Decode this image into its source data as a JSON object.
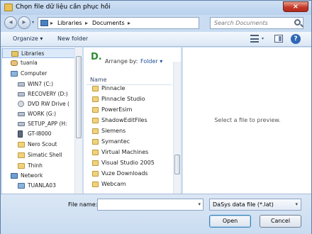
{
  "window": {
    "title": "Chọn file dữ liệu cần phục hồi",
    "close_glyph": "×"
  },
  "address": {
    "root_sep": "▸",
    "crumbs": [
      "Libraries",
      "Documents"
    ],
    "crumb_sep": "▸"
  },
  "search": {
    "placeholder": "Search Documents"
  },
  "toolbar": {
    "organize": "Organize ▾",
    "new_folder": "New folder",
    "help_glyph": "?"
  },
  "nav": {
    "items": [
      {
        "label": "Libraries",
        "icon": "libraries-icon"
      },
      {
        "label": "tuanla",
        "icon": "user-folder-icon"
      },
      {
        "label": "Computer",
        "icon": "computer-icon"
      },
      {
        "label": "WIN7 (C:)",
        "icon": "drive-icon"
      },
      {
        "label": "RECOVERY (D:)",
        "icon": "drive-icon"
      },
      {
        "label": "DVD RW Drive (",
        "icon": "dvd-drive-icon"
      },
      {
        "label": "WORK (G:)",
        "icon": "drive-icon"
      },
      {
        "label": "SETUP_APP (H:",
        "icon": "drive-icon"
      },
      {
        "label": "GT-I8000",
        "icon": "phone-icon"
      },
      {
        "label": "Nero Scout",
        "icon": "folder-icon"
      },
      {
        "label": "Simatic Shell",
        "icon": "folder-icon"
      },
      {
        "label": "Thinh",
        "icon": "folder-icon"
      },
      {
        "label": "Network",
        "icon": "network-icon"
      },
      {
        "label": "TUANLA03",
        "icon": "computer-icon"
      }
    ]
  },
  "content": {
    "arrange_label": "Arrange by:",
    "arrange_value": "Folder ▾",
    "column_name": "Name",
    "files": [
      "Pinnacle",
      "Pinnacle Studio",
      "PowerEsim",
      "ShadowEditFiles",
      "Siemens",
      "Symantec",
      "Virtual Machines",
      "Visual Studio 2005",
      "Vuze Downloads",
      "Webcam"
    ]
  },
  "preview": {
    "message": "Select a file to preview."
  },
  "footer": {
    "file_name_label": "File name:",
    "file_name_value": "",
    "file_type": "DaSys data file (*.lat)",
    "open_label": "Open",
    "cancel_label": "Cancel"
  }
}
